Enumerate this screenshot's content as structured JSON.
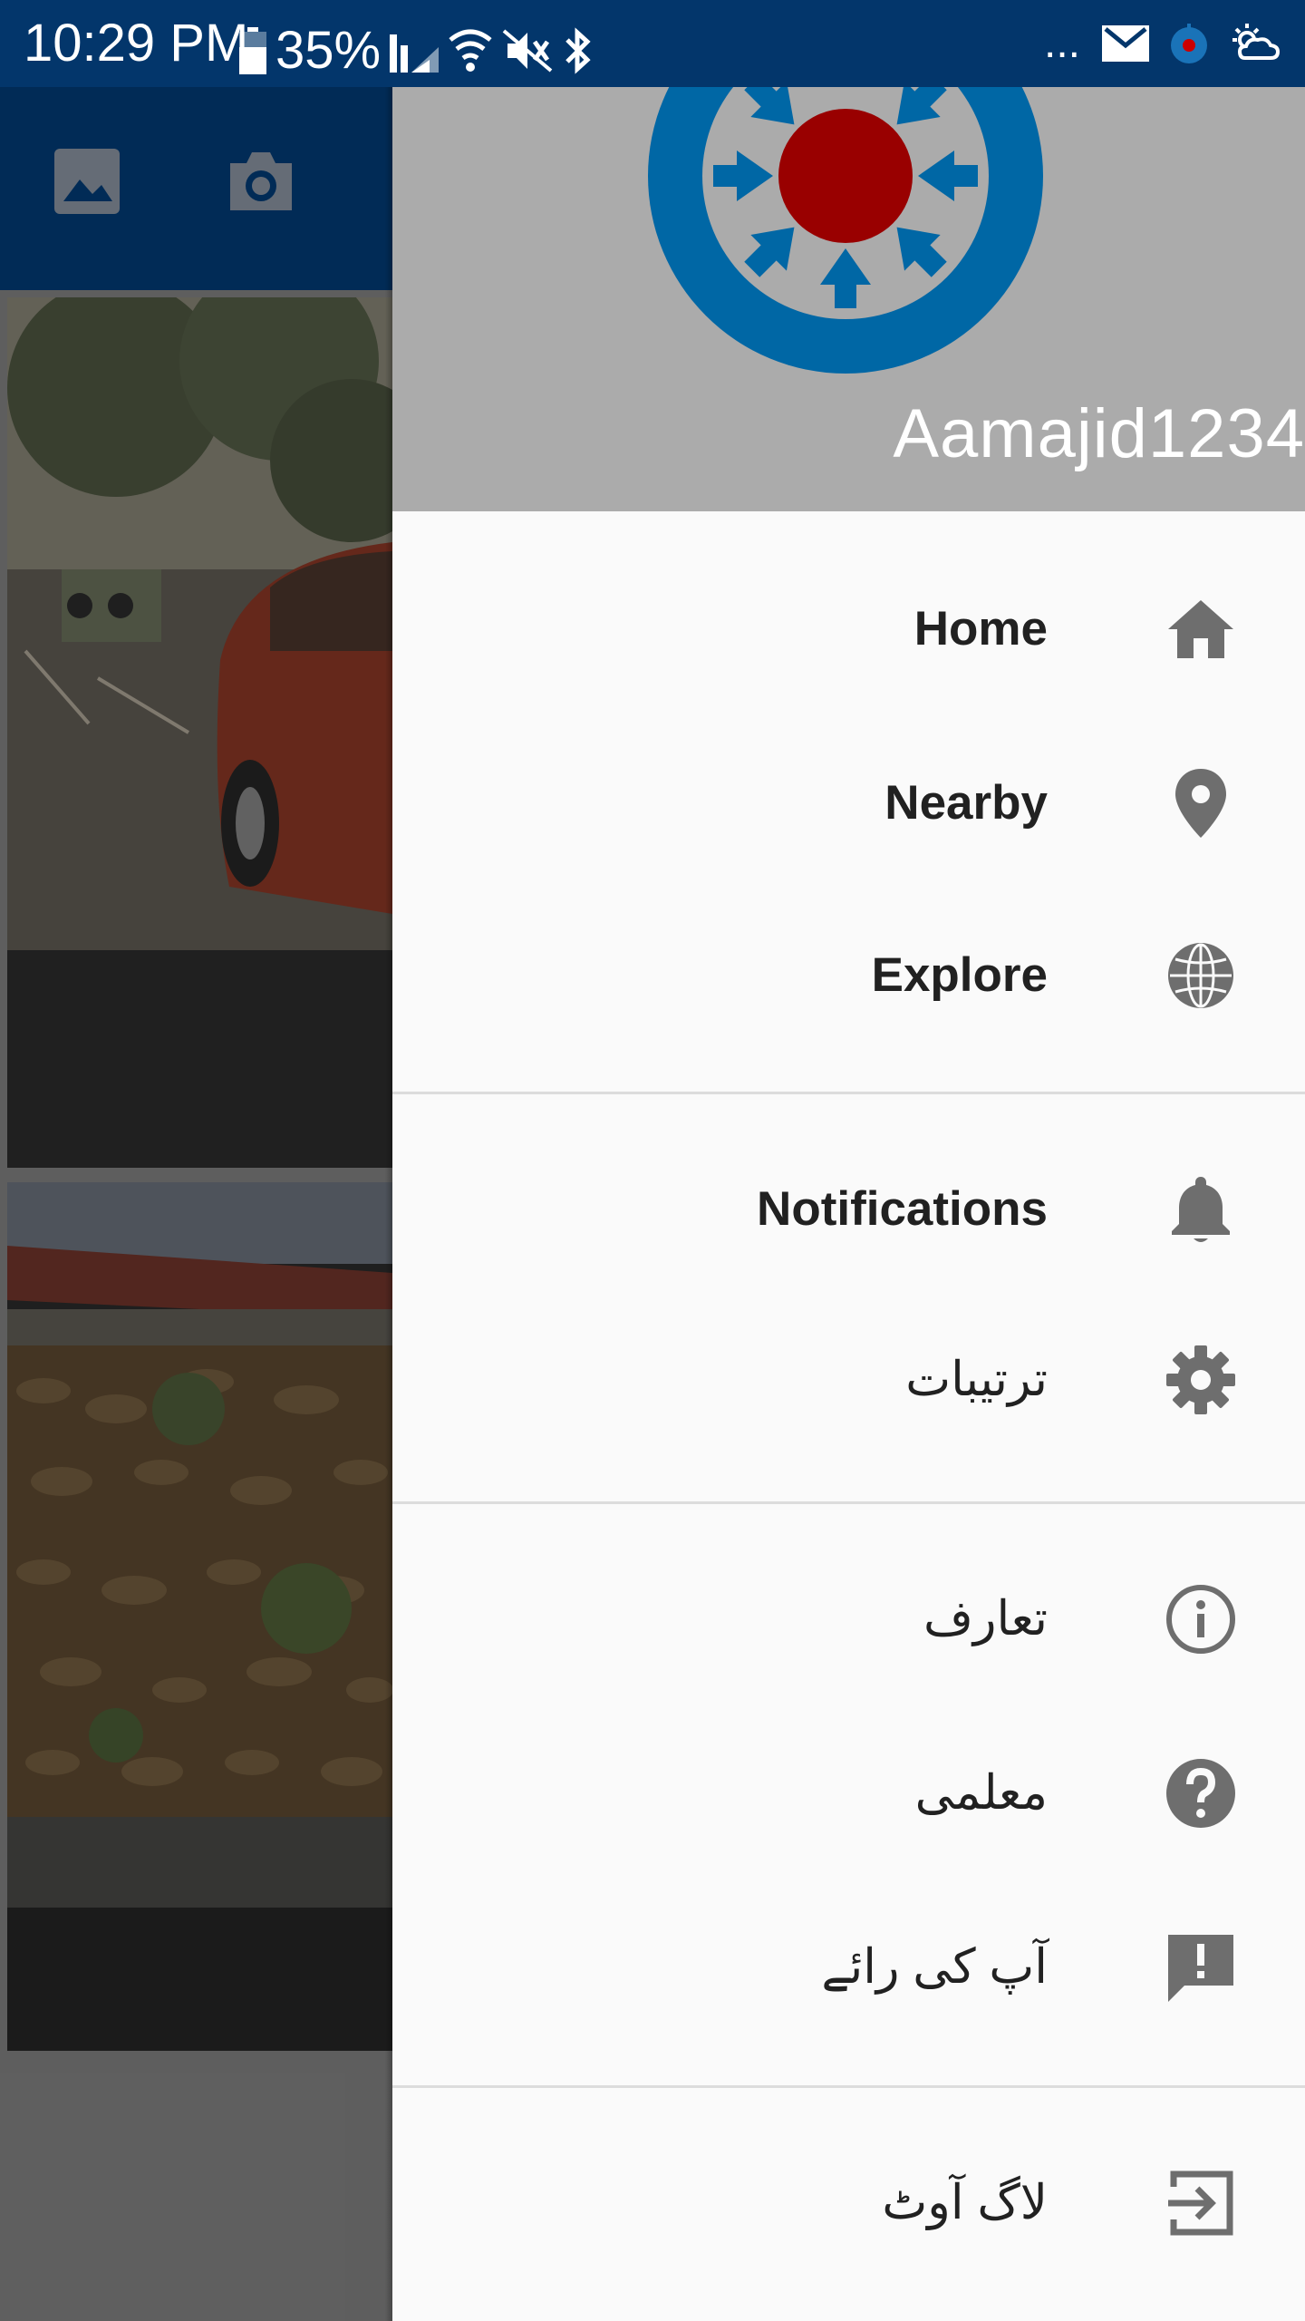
{
  "status_bar": {
    "time": "10:29 PM",
    "battery": "35%",
    "overflow": "..."
  },
  "drawer": {
    "username": "Aamajid1234",
    "items": [
      {
        "label": "Home",
        "icon": "home-icon"
      },
      {
        "label": "Nearby",
        "icon": "location-pin-icon"
      },
      {
        "label": "Explore",
        "icon": "globe-icon"
      },
      {
        "label": "Notifications",
        "icon": "bell-icon"
      },
      {
        "label": "ترتیبات",
        "icon": "gear-icon"
      },
      {
        "label": "تعارف",
        "icon": "info-icon"
      },
      {
        "label": "معلمی",
        "icon": "help-icon"
      },
      {
        "label": "آپ کی رائے",
        "icon": "feedback-icon"
      },
      {
        "label": "لاگ آوٹ",
        "icon": "logout-icon"
      }
    ]
  },
  "colors": {
    "status_bar": "#03366b",
    "toolbar": "#022f5e",
    "drawer_header": "#ababab",
    "logo_blue": "#0067a5",
    "logo_red": "#990000",
    "icon_gray": "#6e6e6e"
  }
}
